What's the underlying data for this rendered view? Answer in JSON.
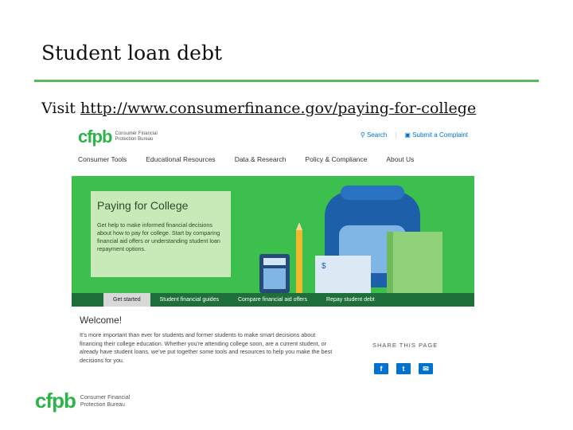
{
  "slide": {
    "title": "Student loan debt",
    "visit_prefix": "Visit",
    "visit_link": "http://www.consumerfinance.gov/paying-for-college"
  },
  "site": {
    "logo": "cfpb",
    "logo_sub_line1": "Consumer Financial",
    "logo_sub_line2": "Protection Bureau",
    "search_label": "Search",
    "complaint_label": "Submit a Complaint",
    "nav": [
      "Consumer Tools",
      "Educational Resources",
      "Data & Research",
      "Policy & Compliance",
      "About Us"
    ],
    "hero": {
      "title": "Paying for College",
      "body": "Get help to make informed financial decisions about how to pay for college. Start by comparing financial aid offers or understanding student loan repayment options."
    },
    "tabs": [
      "Get started",
      "Student financial guides",
      "Compare financial aid offers",
      "Repay student debt"
    ],
    "welcome_title": "Welcome!",
    "welcome_body": "It’s more important than ever for students and former students to make smart decisions about financing their college education. Whether you’re attending college soon, are a current student, or already have student loans, we’ve put together some tools and resources to help you make the best decisions for you.",
    "share_title": "SHARE THIS PAGE",
    "share_icons": [
      "facebook-icon",
      "twitter-icon",
      "email-icon"
    ],
    "accent": "#2cb34a"
  },
  "footer": {
    "logo": "cfpb",
    "logo_sub_line1": "Consumer Financial",
    "logo_sub_line2": "Protection Bureau"
  }
}
